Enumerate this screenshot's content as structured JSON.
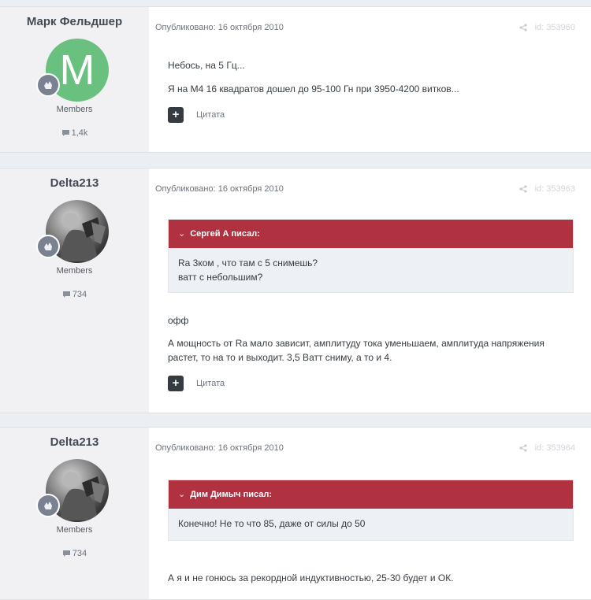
{
  "posts": [
    {
      "author": "Марк Фельдшер",
      "avatar_letter": "M",
      "group": "Members",
      "post_count": "1,4k",
      "published": "Опубликовано: 16 октября 2010",
      "post_id": "id: 353960",
      "lines": [
        "Небось, на 5 Гц...",
        "Я на М4 16 квадратов дошел до 95-100 Гн при 3950-4200 витков..."
      ],
      "cite_label": "Цитата"
    },
    {
      "author": "Delta213",
      "group": "Members",
      "post_count": "734",
      "published": "Опубликовано: 16 октября 2010",
      "post_id": "id: 353963",
      "quote_author": "Сергей А писал:",
      "quote_lines": [
        "Ra 3ком , что там с 5 снимешь?",
        "ватт с небольшим?"
      ],
      "lines": [
        "офф",
        "А мощность от Ra мало зависит, амплитуду тока уменьшаем, амплитуда напряжения",
        "растет, то на то и выходит. 3,5 Ватт сниму, а то и 4."
      ],
      "cite_label": "Цитата"
    },
    {
      "author": "Delta213",
      "group": "Members",
      "post_count": "734",
      "published": "Опубликовано: 16 октября 2010",
      "post_id": "id: 353964",
      "quote_author": "Дим Димыч писал:",
      "quote_lines": [
        "Конечно! Не то что 85, даже от силы до 50"
      ],
      "lines": [
        "А я и не гонюсь за рекордной индуктивностью, 25-30 будет и ОК."
      ]
    }
  ],
  "colors": {
    "quote_header": "#b0313f",
    "avatar_green": "#6ac07e",
    "author_bg": "#f1f1f3"
  }
}
